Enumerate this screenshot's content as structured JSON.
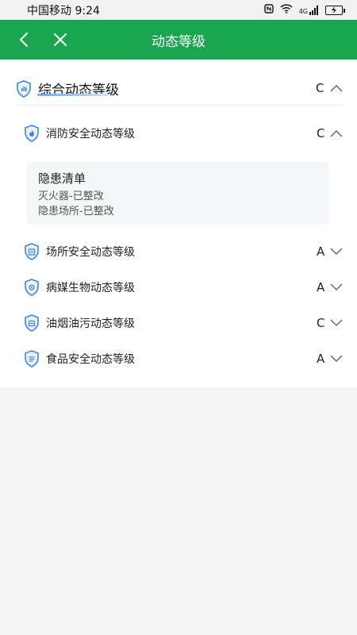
{
  "status_bar": {
    "carrier_time": "中国移动 9:24",
    "signal_text": "4G"
  },
  "header": {
    "title": "动态等级",
    "back_icon": "chevron-left-icon",
    "close_icon": "close-icon"
  },
  "summary": {
    "label": "综合动态等级",
    "grade": "C",
    "expanded": true
  },
  "categories": [
    {
      "label": "消防安全动态等级",
      "grade": "C",
      "expanded": true
    },
    {
      "label": "场所安全动态等级",
      "grade": "A",
      "expanded": false
    },
    {
      "label": "病媒生物动态等级",
      "grade": "A",
      "expanded": false
    },
    {
      "label": "油烟油污动态等级",
      "grade": "C",
      "expanded": false
    },
    {
      "label": "食品安全动态等级",
      "grade": "A",
      "expanded": false
    }
  ],
  "hazard_list": {
    "title": "隐患清单",
    "items": [
      "灭火器-已整改",
      "隐患场所-已整改"
    ]
  },
  "colors": {
    "brand_green": "#1aa650",
    "icon_blue": "#3d86e8"
  }
}
